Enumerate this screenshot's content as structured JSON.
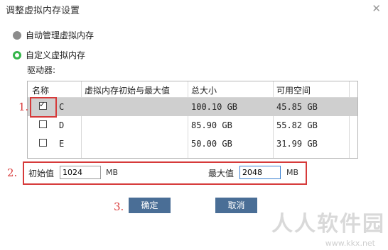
{
  "window": {
    "title": "调整虚拟内存设置"
  },
  "options": {
    "auto_label": "自动管理虚拟内存",
    "custom_label": "自定义虚拟内存",
    "selected": "custom"
  },
  "drives_label": "驱动器:",
  "table": {
    "headers": [
      "名称",
      "虚拟内存初始与最大值",
      "总大小",
      "可用空间"
    ],
    "rows": [
      {
        "name": "C",
        "range": "",
        "total": "100.10 GB",
        "free": "45.85 GB",
        "checked": true,
        "selected": true
      },
      {
        "name": "D",
        "range": "",
        "total": "85.90 GB",
        "free": "55.82 GB",
        "checked": false,
        "selected": false
      },
      {
        "name": "E",
        "range": "",
        "total": "50.00 GB",
        "free": "31.99 GB",
        "checked": false,
        "selected": false
      }
    ]
  },
  "sizes": {
    "initial_label": "初始值",
    "initial_value": "1024",
    "initial_unit": "MB",
    "max_label": "最大值",
    "max_value": "2048",
    "max_unit": "MB"
  },
  "buttons": {
    "ok": "确定",
    "cancel": "取消"
  },
  "annotations": [
    "1.",
    "2.",
    "3."
  ],
  "watermark": {
    "text": "人人软件园",
    "url": "www.kkx.net"
  },
  "colors": {
    "accent_radio": "#34b54a",
    "button": "#4a6e96",
    "annotation": "#d63a3a",
    "selected_row": "#cfcfcf"
  }
}
